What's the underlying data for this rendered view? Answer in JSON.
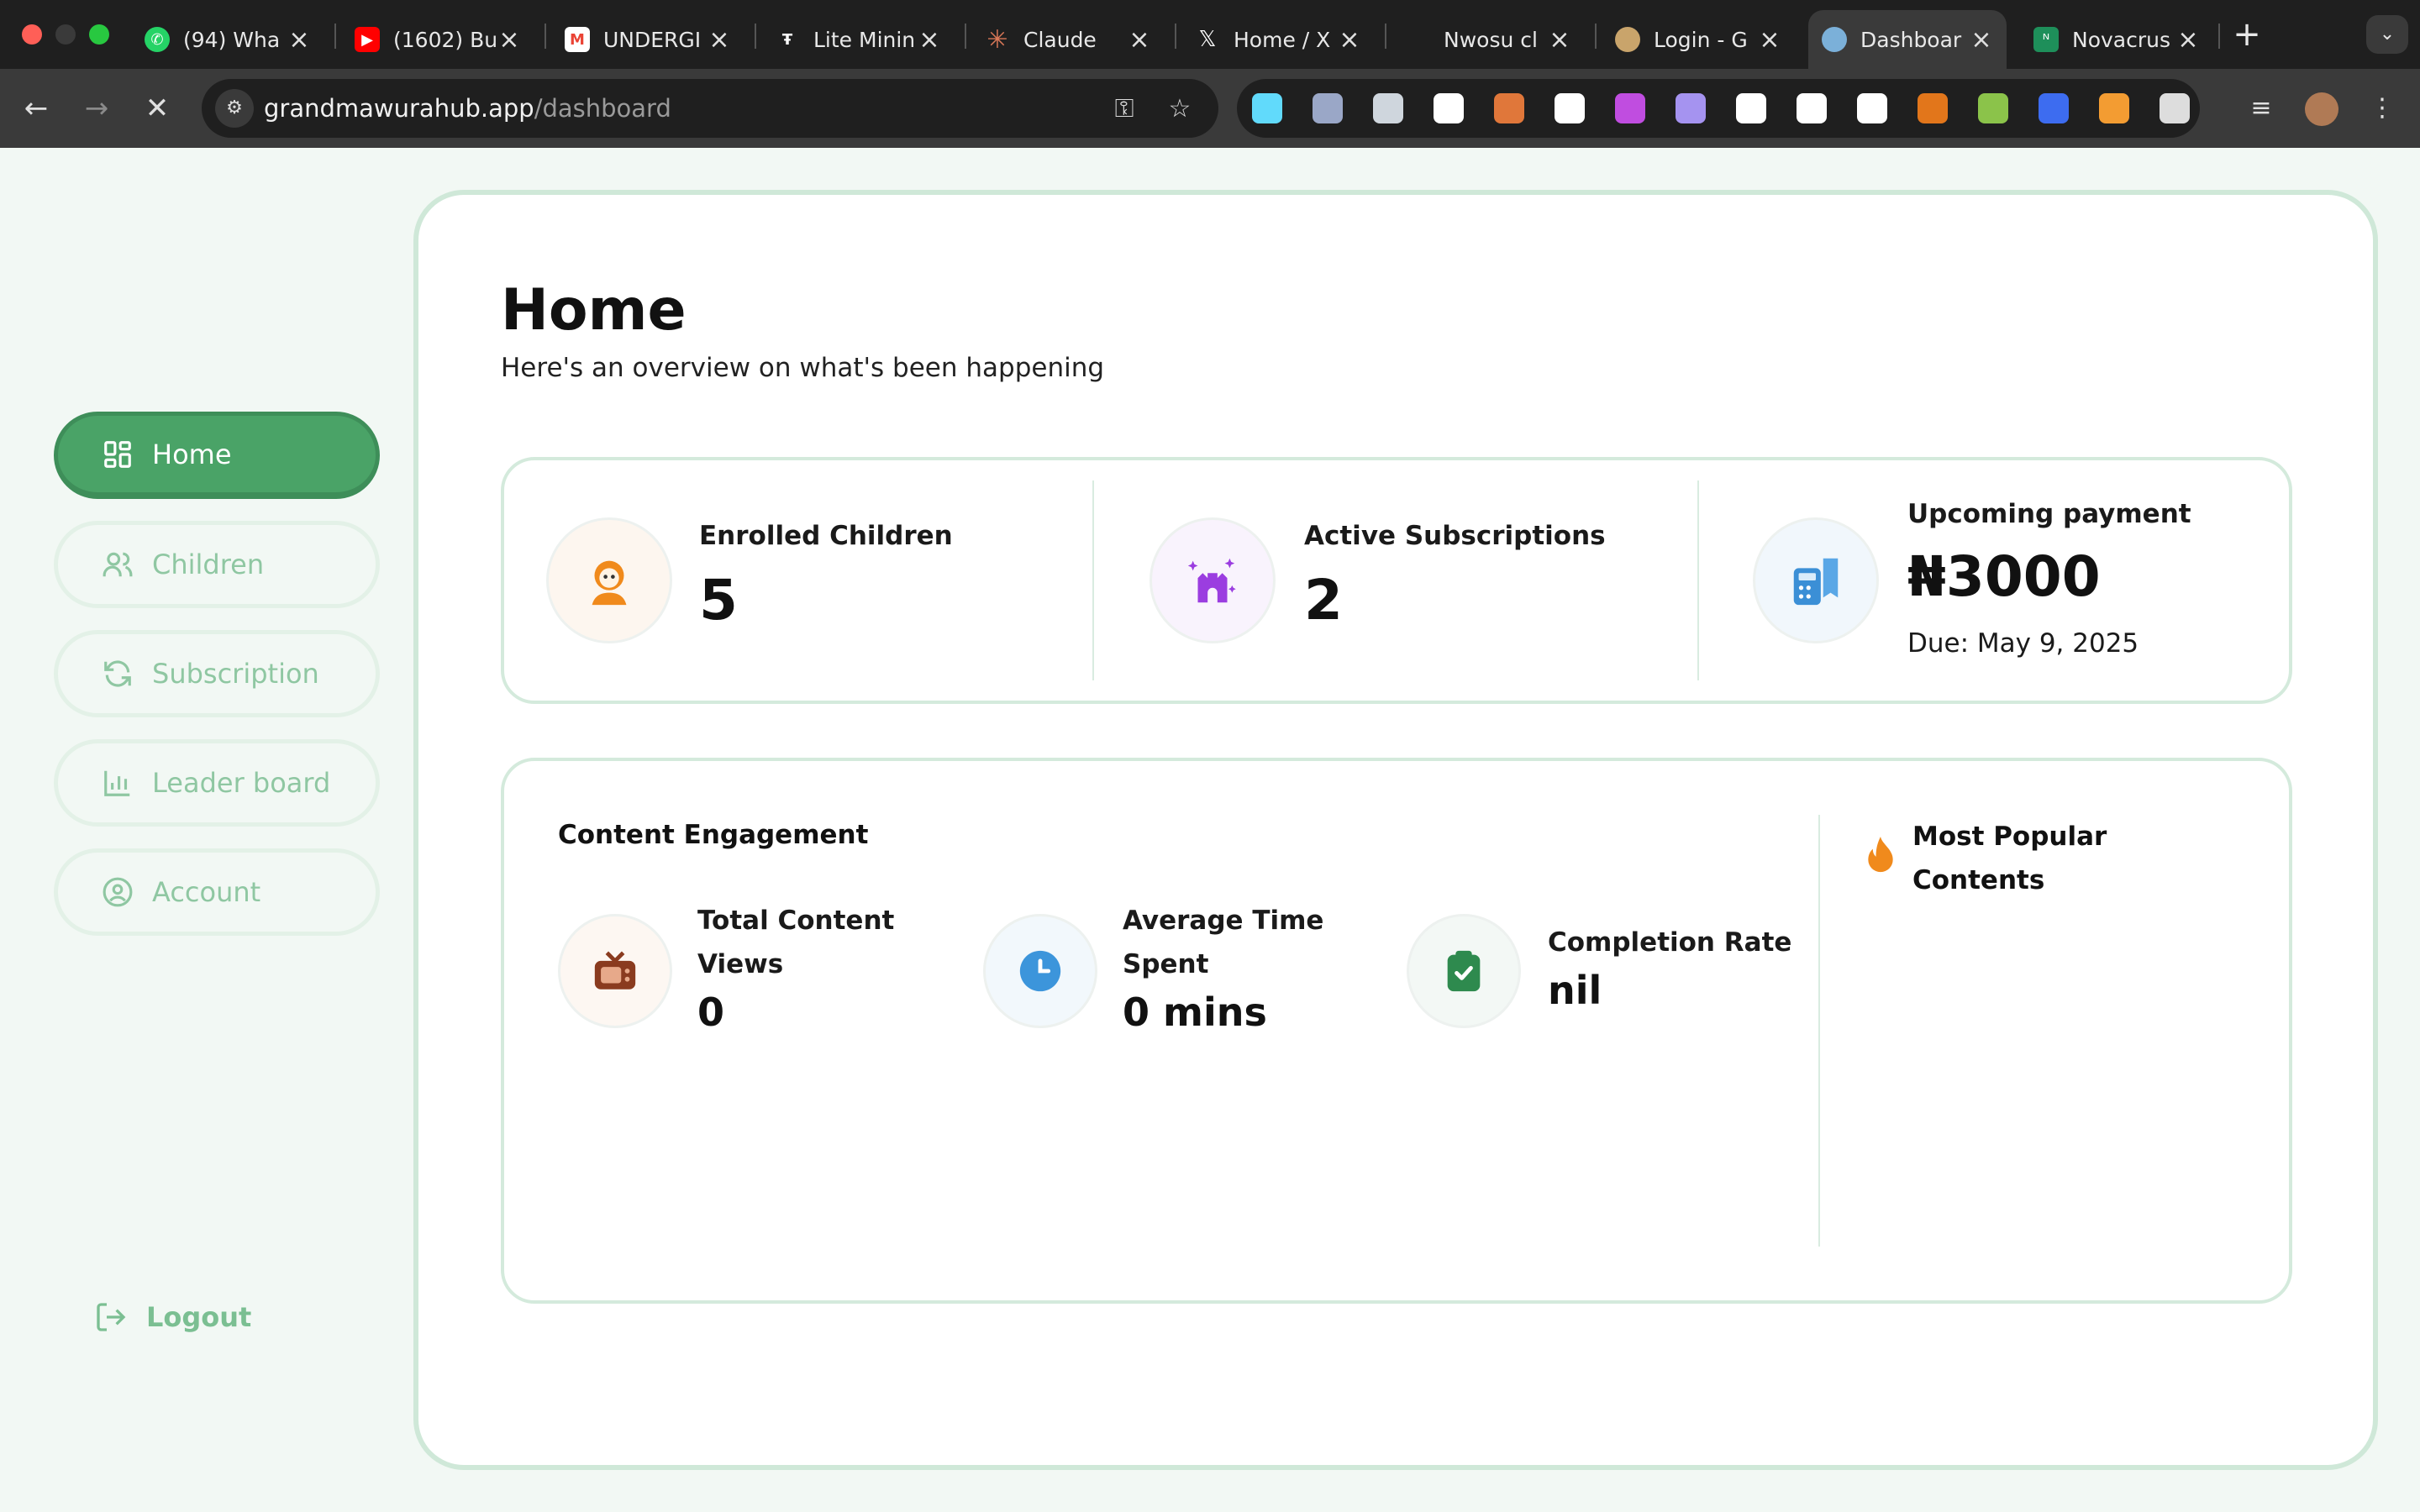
{
  "browser": {
    "tabs": [
      {
        "title": "(94) Wha",
        "favicon": "whatsapp-icon",
        "color": "#25d366"
      },
      {
        "title": "(1602) Bu",
        "favicon": "youtube-icon",
        "color": "#ff0000"
      },
      {
        "title": "UNDERGI",
        "favicon": "gmail-icon",
        "color": "#ea4335"
      },
      {
        "title": "Lite Minin",
        "favicon": "lite-mining-icon",
        "color": "#ffffff"
      },
      {
        "title": "Claude",
        "favicon": "claude-icon",
        "color": "#d97757"
      },
      {
        "title": "Home / X",
        "favicon": "x-icon",
        "color": "#ffffff"
      },
      {
        "title": "Nwosu cl",
        "favicon": "blank-icon",
        "color": "#1f1f1f"
      },
      {
        "title": "Login - G",
        "favicon": "grandma-icon",
        "color": "#c9a46b"
      },
      {
        "title": "Dashboar",
        "favicon": "grandma-icon",
        "color": "#7bb0d9"
      },
      {
        "title": "Novacrus",
        "favicon": "novacrust-icon",
        "color": "#1e8f5a"
      }
    ],
    "url_host": "grandmawurahub.app",
    "url_path": "/dashboard",
    "extension_colors": [
      "#61dafb",
      "#9aa7c7",
      "#cfd6dd",
      "#ffffff",
      "#e0773a",
      "#ffffff",
      "#c04de0",
      "#a593f0",
      "#ffffff",
      "#ffffff",
      "#ffffff",
      "#e2761b",
      "#8bc34a",
      "#3d6cf0",
      "#f39c32",
      "#dddddd"
    ]
  },
  "sidebar": {
    "items": [
      {
        "label": "Home",
        "icon": "grid-icon"
      },
      {
        "label": "Children",
        "icon": "users-icon"
      },
      {
        "label": "Subscription",
        "icon": "refresh-icon"
      },
      {
        "label": "Leader board",
        "icon": "bar-chart-icon"
      },
      {
        "label": "Account",
        "icon": "user-circle-icon"
      }
    ],
    "logout_label": "Logout"
  },
  "header": {
    "title": "Home",
    "subtitle": "Here's an overview on what's been happening"
  },
  "stats": {
    "enrolled_label": "Enrolled Children",
    "enrolled_value": "5",
    "subscriptions_label": "Active Subscriptions",
    "subscriptions_value": "2",
    "payment_label": "Upcoming payment",
    "payment_value": "₦3000",
    "payment_due": "Due: May 9, 2025"
  },
  "engagement": {
    "title": "Content Engagement",
    "views_label": "Total Content Views",
    "views_value": "0",
    "time_label": "Average Time Spent",
    "time_value": "0 mins",
    "completion_label": "Completion Rate",
    "completion_value": "nil",
    "popular_title": "Most Popular Contents"
  },
  "colors": {
    "brand_green": "#4aa367",
    "sidebar_text": "#8fc7a2",
    "card_border": "#d4eadc"
  }
}
